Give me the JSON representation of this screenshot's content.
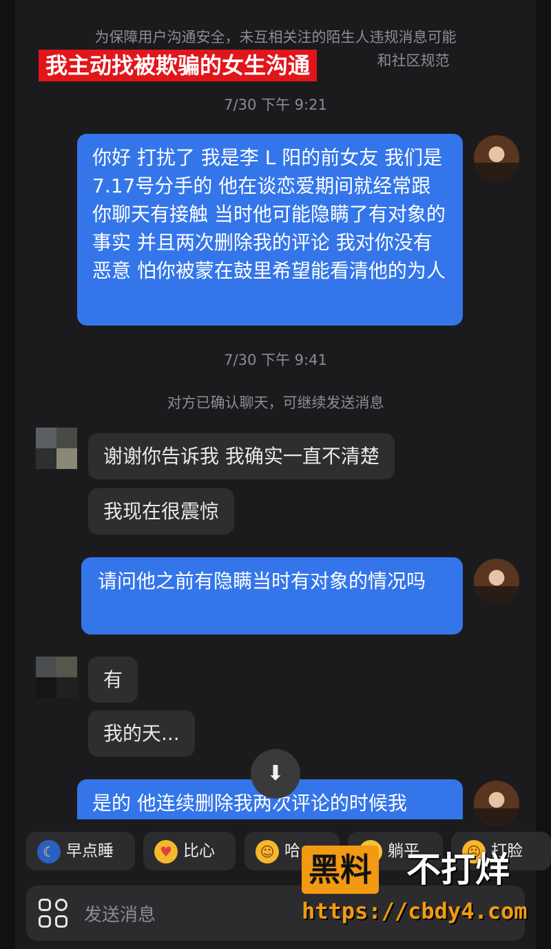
{
  "notice": {
    "line1": "为保障用户沟通安全，未互相关注的陌生人违规消息可能",
    "line2_visible": "和社区规范"
  },
  "banner": "我主动找被欺骗的女生沟通",
  "timestamps": [
    "7/30 下午 9:21",
    "7/30 下午 9:41"
  ],
  "system_message": "对方已确认聊天，可继续发送消息",
  "messages": [
    {
      "from": "me",
      "text": "你好 打扰了 我是李 L 阳的前女友 我们是7.17号分手的 他在谈恋爱期间就经常跟你聊天有接触 当时他可能隐瞒了有对象的事实 并且两次删除我的评论 我对你没有恶意 怕你被蒙在鼓里希望能看清他的为人"
    },
    {
      "from": "them",
      "text": "谢谢你告诉我 我确实一直不清楚"
    },
    {
      "from": "them",
      "text": "我现在很震惊"
    },
    {
      "from": "me",
      "text": "请问他之前有隐瞒当时有对象的情况吗"
    },
    {
      "from": "them",
      "text": "有"
    },
    {
      "from": "them",
      "text": "我的天..."
    },
    {
      "from": "me",
      "text": "是的 他连续删除我两次评论的时候我"
    }
  ],
  "scroll_button_icon": "chevron-double-down-icon",
  "quick_replies": [
    {
      "label": "早点睡",
      "icon": "moon-emoji-icon"
    },
    {
      "label": "比心",
      "icon": "heart-hands-emoji-icon"
    },
    {
      "label": "哈",
      "icon": "laughing-emoji-icon"
    },
    {
      "label": "躺平",
      "icon": "lying-flat-emoji-icon"
    },
    {
      "label": "打脸",
      "icon": "face-slap-emoji-icon"
    }
  ],
  "input": {
    "placeholder": "发送消息"
  },
  "watermark": {
    "badge": "黑料",
    "text": "不打烊",
    "url": "https://cbdy4.com"
  },
  "colors": {
    "my_bubble": "#3476ea",
    "their_bubble": "#2e2e31",
    "background": "#1b1b1e",
    "banner": "#e0161b",
    "watermark": "#f29a12"
  }
}
